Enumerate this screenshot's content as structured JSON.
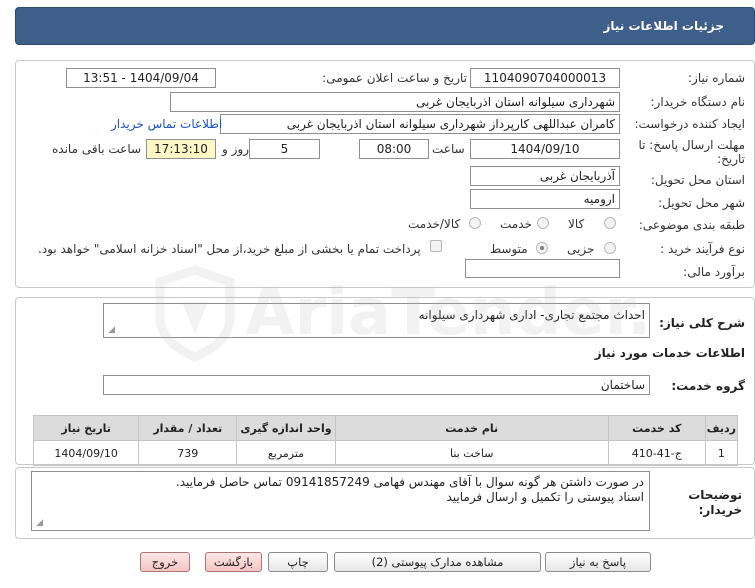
{
  "header": {
    "title": "جزئیات اطلاعات نیاز"
  },
  "form": {
    "need_number_label": "شماره نیاز:",
    "need_number": "1104090704000013",
    "announce_datetime_label": "تاریخ و ساعت اعلان عمومی:",
    "announce_datetime": "1404/09/04 - 13:51",
    "buyer_org_label": "نام دستگاه خریدار:",
    "buyer_org": "شهرداری سیلوانه استان اذربایجان غربی",
    "requester_label": "ایجاد کننده درخواست:",
    "requester": "کامران عبداللهی کارپرداز شهرداری سیلوانه استان اذربایجان غربی",
    "contact_link": "اطلاعات تماس خریدار",
    "deadline_label_1": "مهلت ارسال پاسخ: تا",
    "deadline_label_2": "تاریخ:",
    "deadline_date": "1404/09/10",
    "time_label": "ساعت",
    "deadline_time": "08:00",
    "days": "5",
    "days_label": "روز و",
    "remaining_time": "17:13:10",
    "remaining_label": "ساعت باقی مانده",
    "province_label": "استان محل تحویل:",
    "province": "آذربایجان غربی",
    "city_label": "شهر محل تحویل:",
    "city": "ارومیه",
    "category_label": "طبقه بندی موضوعی:",
    "category_options": [
      "کالا",
      "خدمت",
      "کالا/خدمت"
    ],
    "process_label": "نوع فرآیند خرید :",
    "process_options": [
      "جزیی",
      "متوسط"
    ],
    "payment_note": "پرداخت تمام یا بخشی از مبلغ خرید،از محل \"اسناد خزانه اسلامی\" خواهد بود.",
    "financial_label": "برآورد مالی:",
    "financial_value": ""
  },
  "description": {
    "label": "شرح کلی نیاز:",
    "text": "احداث مجتمع تجاری- اداری شهرداری سیلوانه"
  },
  "services": {
    "section_title": "اطلاعات خدمات مورد نیاز",
    "group_label": "گروه خدمت:",
    "group_value": "ساختمان",
    "columns": [
      "ردیف",
      "کد خدمت",
      "نام خدمت",
      "واحد اندازه گیری",
      "تعداد / مقدار",
      "تاریخ نیاز"
    ],
    "rows": [
      [
        "1",
        "ج-41-410",
        "ساخت بنا",
        "مترمربع",
        "739",
        "1404/09/10"
      ]
    ]
  },
  "notes": {
    "label_1": "توضیحات",
    "label_2": "خریدار:",
    "line_1": "در صورت داشتن هر گونه سوال با آقای مهندس فهامی 09141857249  تماس حاصل فرمایید.",
    "line_2": "اسناد پیوستی را تکمیل و ارسال فرمایید"
  },
  "buttons": {
    "reply": "پاسخ به نیاز",
    "attachments": "مشاهده مدارک پیوستی (2)",
    "print": "چاپ",
    "back": "بازگشت",
    "exit": "خروج"
  },
  "watermark": {
    "text": "AriaTender.net"
  },
  "colors": {
    "title_bg": "#3e5f8a",
    "remaining_bg": "#fdf6c5",
    "link": "#1a52c8",
    "exit_bg": "#f6c4c4"
  }
}
